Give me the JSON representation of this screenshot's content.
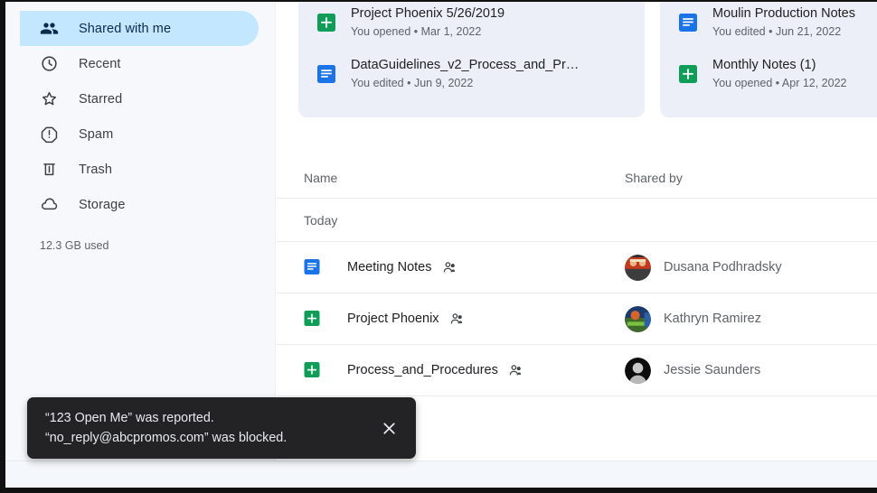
{
  "sidebar": {
    "items": [
      {
        "label": "Shared with me",
        "icon": "people-icon",
        "active": true
      },
      {
        "label": "Recent",
        "icon": "clock-icon",
        "active": false
      },
      {
        "label": "Starred",
        "icon": "star-icon",
        "active": false
      },
      {
        "label": "Spam",
        "icon": "spam-icon",
        "active": false
      },
      {
        "label": "Trash",
        "icon": "trash-icon",
        "active": false
      },
      {
        "label": "Storage",
        "icon": "cloud-icon",
        "active": false
      }
    ],
    "storage_used": "12.3 GB used",
    "active_pill_color": "#c2e7ff",
    "background_color": "#f6f8fc"
  },
  "cards": {
    "background_color": "#eceff8",
    "items": [
      {
        "rows": [
          {
            "title": "Project Phoenix 5/26/2019",
            "subtitle": "You opened • Mar 1, 2022",
            "icon": "google-sheets-icon"
          },
          {
            "title": "DataGuidelines_v2_Process_and_Pr…",
            "subtitle": "You edited • Jun 9, 2022",
            "icon": "google-docs-icon"
          }
        ]
      },
      {
        "rows": [
          {
            "title": "Moulin Production Notes",
            "subtitle": "You edited • Jun 21, 2022",
            "icon": "google-docs-icon"
          },
          {
            "title": "Monthly Notes (1)",
            "subtitle": "You opened • Apr 12, 2022",
            "icon": "google-sheets-icon"
          }
        ]
      }
    ]
  },
  "table": {
    "columns": {
      "name": "Name",
      "shared_by": "Shared by"
    },
    "group_label": "Today",
    "rows": [
      {
        "name": "Meeting Notes",
        "icon": "google-docs-icon",
        "shared_by": "Dusana Podhradsky",
        "avatar": "photo-avatar-1"
      },
      {
        "name": "Project Phoenix",
        "icon": "google-sheets-icon",
        "shared_by": "Kathryn Ramirez",
        "avatar": "photo-avatar-2"
      },
      {
        "name": "Process_and_Procedures",
        "icon": "google-sheets-icon",
        "shared_by": "Jessie Saunders",
        "avatar": "photo-avatar-3"
      }
    ]
  },
  "toast": {
    "line1": "“123 Open Me” was reported.",
    "line2": "“no_reply@abcpromos.com” was blocked.",
    "close_icon": "close-icon",
    "background_color": "#232326"
  }
}
